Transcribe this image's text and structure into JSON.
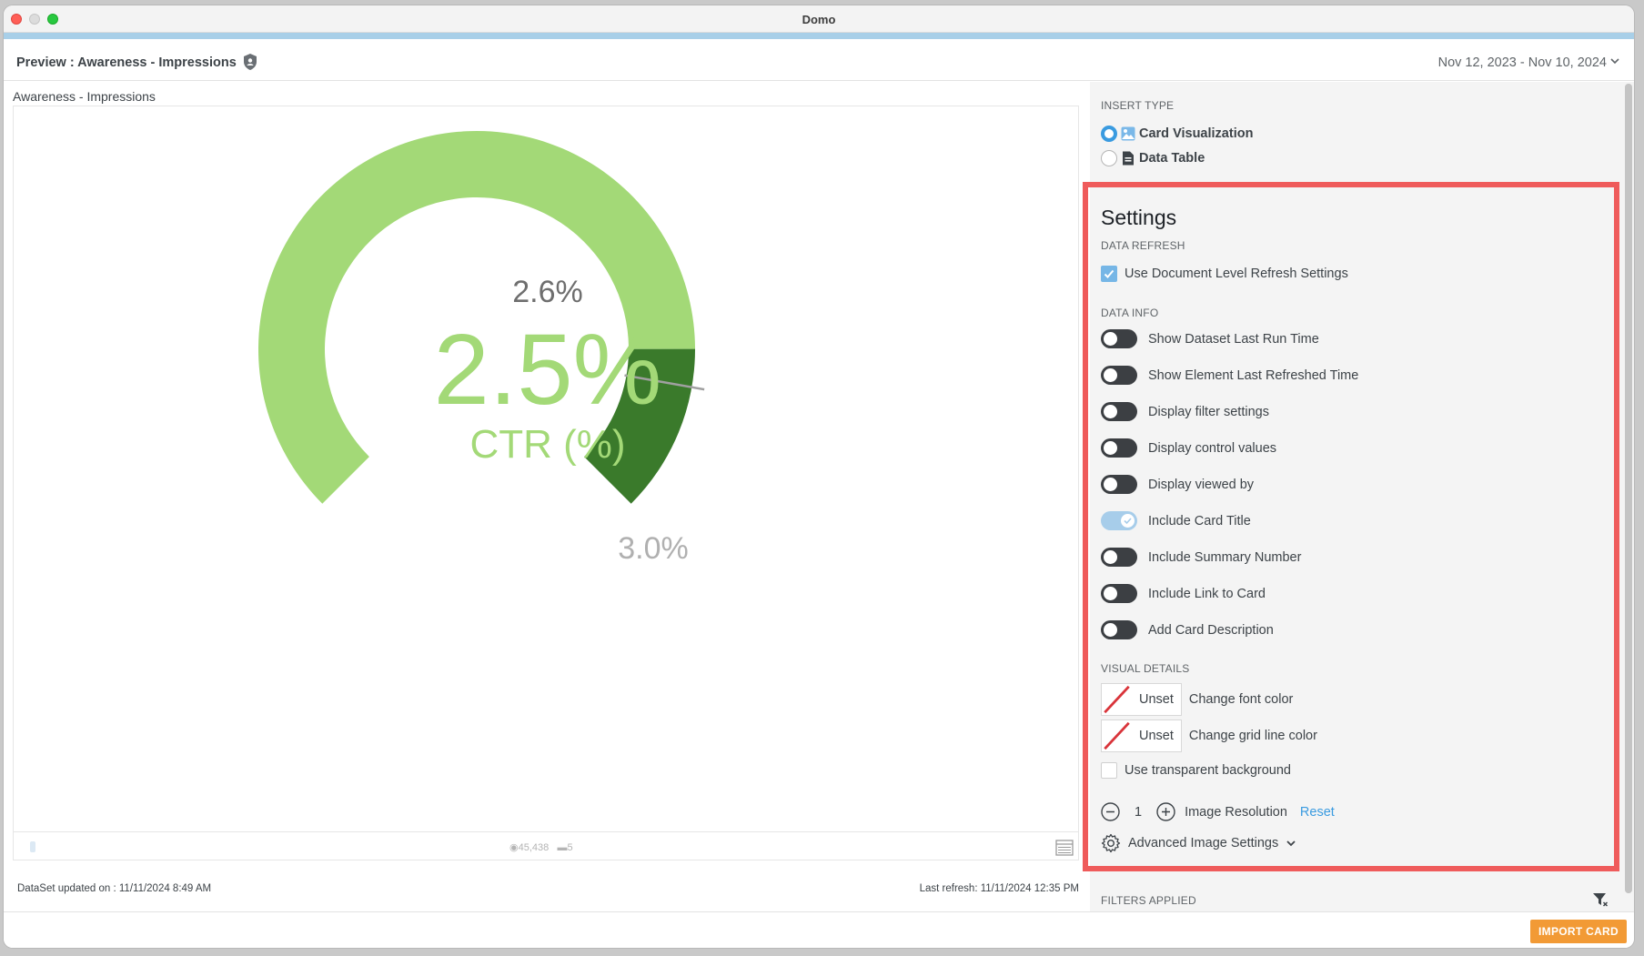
{
  "window": {
    "title": "Domo"
  },
  "header": {
    "preview_title": "Preview : Awareness - Impressions",
    "date_range": "Nov 12, 2023 - Nov 10, 2024"
  },
  "card": {
    "title": "Awareness - Impressions",
    "gauge": {
      "value_label": "2.5%",
      "metric_label": "CTR (%)",
      "target_label": "2.6%",
      "max_label": "3.0%",
      "fill_fraction": 0.833,
      "colors": {
        "track": "#a3d977",
        "fill": "#3a7a2b",
        "needle": "#a0a0a0"
      }
    },
    "footer": {
      "views": "45,438",
      "comments": "5"
    },
    "dataset_updated": "DataSet updated on : 11/11/2024 8:49 AM",
    "last_refresh": "Last refresh: 11/11/2024 12:35 PM"
  },
  "panel": {
    "insert_type_label": "INSERT TYPE",
    "insert_options": [
      {
        "label": "Card Visualization",
        "selected": true,
        "icon": "image-icon"
      },
      {
        "label": "Data Table",
        "selected": false,
        "icon": "document-icon"
      }
    ],
    "settings_title": "Settings",
    "data_refresh_label": "DATA REFRESH",
    "doc_refresh": {
      "label": "Use Document Level Refresh Settings",
      "checked": true
    },
    "data_info_label": "DATA INFO",
    "toggles": [
      {
        "label": "Show Dataset Last Run Time",
        "on": false
      },
      {
        "label": "Show Element Last Refreshed Time",
        "on": false
      },
      {
        "label": "Display filter settings",
        "on": false
      },
      {
        "label": "Display control values",
        "on": false
      },
      {
        "label": "Display viewed by",
        "on": false
      },
      {
        "label": "Include Card Title",
        "on": true
      },
      {
        "label": "Include Summary Number",
        "on": false
      },
      {
        "label": "Include Link to Card",
        "on": false
      },
      {
        "label": "Add Card Description",
        "on": false
      }
    ],
    "visual_details_label": "VISUAL DETAILS",
    "font_color": {
      "value": "Unset",
      "label": "Change font color"
    },
    "grid_color": {
      "value": "Unset",
      "label": "Change grid line color"
    },
    "transparent_bg": {
      "label": "Use transparent background",
      "checked": false
    },
    "image_resolution": {
      "value": "1",
      "label": "Image Resolution",
      "reset": "Reset"
    },
    "advanced": {
      "label": "Advanced Image Settings"
    },
    "filters_label": "FILTERS APPLIED"
  },
  "footer": {
    "import_label": "IMPORT CARD"
  },
  "colors": {
    "accent": "#3a9be0",
    "highlight_border": "#ef5b5b",
    "import_button": "#f29a35"
  }
}
